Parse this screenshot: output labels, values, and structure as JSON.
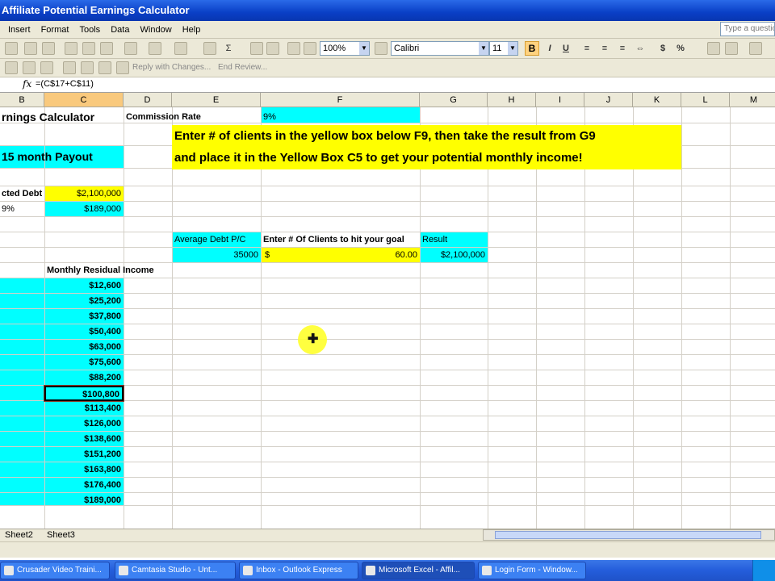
{
  "window": {
    "title": "Affiliate Potential Earnings Calculator"
  },
  "menu": [
    "Insert",
    "Format",
    "Tools",
    "Data",
    "Window",
    "Help"
  ],
  "ask_placeholder": "Type a questio",
  "toolbar": {
    "zoom": "100%",
    "font": "Calibri",
    "font_size": "11",
    "bold": "B",
    "italic": "I",
    "underline": "U",
    "currency": "$",
    "percent": "%",
    "reply_text": "Reply with Changes...",
    "end_review": "End Review..."
  },
  "formula": {
    "fx": "fx",
    "content": "=(C$17+C$11)"
  },
  "columns": [
    "B",
    "C",
    "D",
    "E",
    "F",
    "G",
    "H",
    "I",
    "J",
    "K",
    "L",
    "M"
  ],
  "selected_column": "C",
  "cells": {
    "calc_title": "rnings Calculator",
    "commission_label": "Commission Rate",
    "commission_value": "9%",
    "banner_line1": "Enter # of clients in the yellow box below F9, then take the result from G9",
    "banner_line2": "and place it in the Yellow Box C5 to get your potential monthly income!",
    "payout": "15 month Payout",
    "debt_label": "cted Debt",
    "debt_value": "$2,100,000",
    "pct_label": "9%",
    "pct_value": "$189,000",
    "avg_debt_label": "Average Debt P/C",
    "avg_debt_value": "35000",
    "clients_label": "Enter # Of Clients to hit your goal",
    "clients_currency": "$",
    "clients_value": "60.00",
    "result_label": "Result",
    "result_value": "$2,100,000",
    "residual_header": "Monthly Residual Income"
  },
  "residual_values": [
    "$12,600",
    "$25,200",
    "$37,800",
    "$50,400",
    "$63,000",
    "$75,600",
    "$88,200",
    "$100,800",
    "$113,400",
    "$126,000",
    "$138,600",
    "$151,200",
    "$163,800",
    "$176,400",
    "$189,000"
  ],
  "active_residual_index": 7,
  "sheets": [
    "Sheet2",
    "Sheet3"
  ],
  "taskbar": [
    "Crusader Video Traini...",
    "Camtasia Studio - Unt...",
    "Inbox - Outlook Express",
    "Microsoft Excel - Affil...",
    "Login Form - Window..."
  ],
  "active_task_index": 3,
  "colors": {
    "cyan": "#00ffff",
    "yellow": "#ffff00",
    "title_blue": "#0a3fc6"
  }
}
